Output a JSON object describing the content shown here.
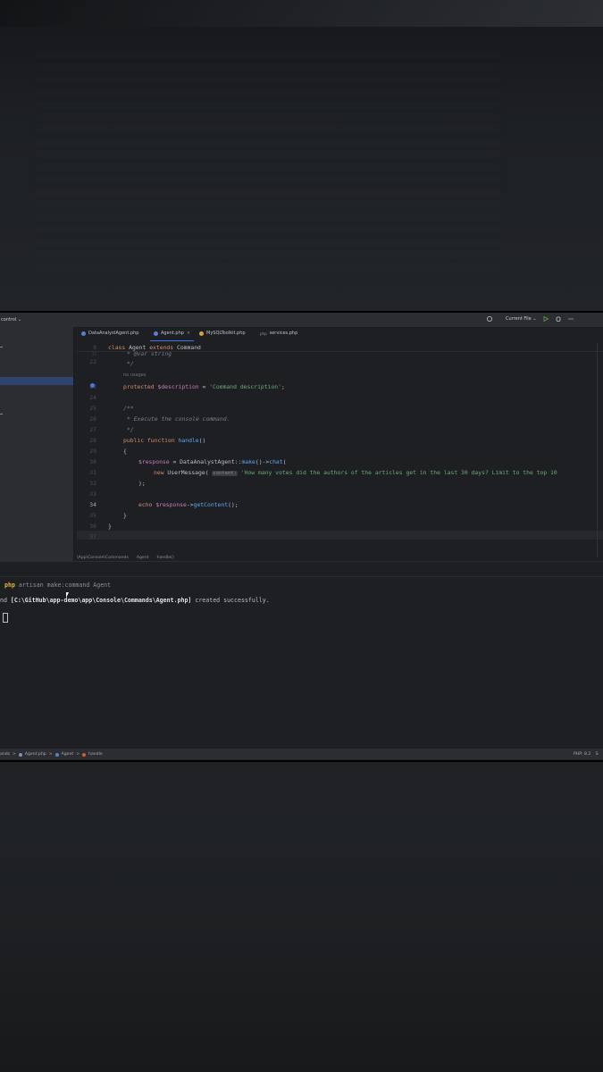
{
  "titlebar": {
    "vcs_label": "control ⌄",
    "run_config": "Current File ⌄"
  },
  "tabs": [
    {
      "label": "DataAnalystAgent.php",
      "icon": "php-class-icon",
      "color": "#5c7fd6"
    },
    {
      "label": "Agent.php",
      "close": "×",
      "icon": "php-class-icon",
      "color": "#5c7fd6"
    },
    {
      "label": "MySQLToolkit.php",
      "icon": "php-class-icon",
      "color": "#d9a13c"
    },
    {
      "label": "services.php",
      "icon": "php-file-icon",
      "color": "#7d8ec6"
    }
  ],
  "editor": {
    "lines": [
      {
        "n": "9",
        "text": "class Agent extends Command"
      },
      {
        "n": "22",
        "text": "* @var string"
      },
      {
        "n": "",
        "text": "*/"
      },
      {
        "n": "",
        "text": "no usages"
      },
      {
        "n": "23",
        "text": "protected $description = 'Command description';"
      },
      {
        "n": "24",
        "text": ""
      },
      {
        "n": "25",
        "text": "/**"
      },
      {
        "n": "26",
        "text": "* Execute the console command."
      },
      {
        "n": "27",
        "text": "*/"
      },
      {
        "n": "28",
        "text": "public function handle()"
      },
      {
        "n": "29",
        "text": "{"
      },
      {
        "n": "30",
        "text": "$response = DataAnalystAgent::make()->chat("
      },
      {
        "n": "31",
        "text": "new UserMessage( content: 'How many votes did the authors of the articles get in the last 30 days? Limit to the top 10"
      },
      {
        "n": "32",
        "text": ");"
      },
      {
        "n": "33",
        "text": ""
      },
      {
        "n": "34",
        "text": "echo $response->getContent();"
      },
      {
        "n": "35",
        "text": "}"
      },
      {
        "n": "36",
        "text": "}"
      },
      {
        "n": "37",
        "text": ""
      }
    ]
  },
  "breadcrumb": [
    "\\App\\Console\\Commands",
    "Agent",
    "handle()"
  ],
  "terminal": {
    "prompt": "php",
    "command": " artisan make:command Agent",
    "output_prefix": "nd ",
    "output_path": "[C:\\GitHub\\app-demo\\app\\Console\\Commands\\Agent.php]",
    "output_suffix": " created successfully."
  },
  "statusbar": {
    "crumbs": [
      "ands",
      ">",
      "Agent.php",
      ">",
      "Agent",
      ">",
      "handle"
    ],
    "php_version": "PHP: 8.2",
    "extra": "S"
  }
}
